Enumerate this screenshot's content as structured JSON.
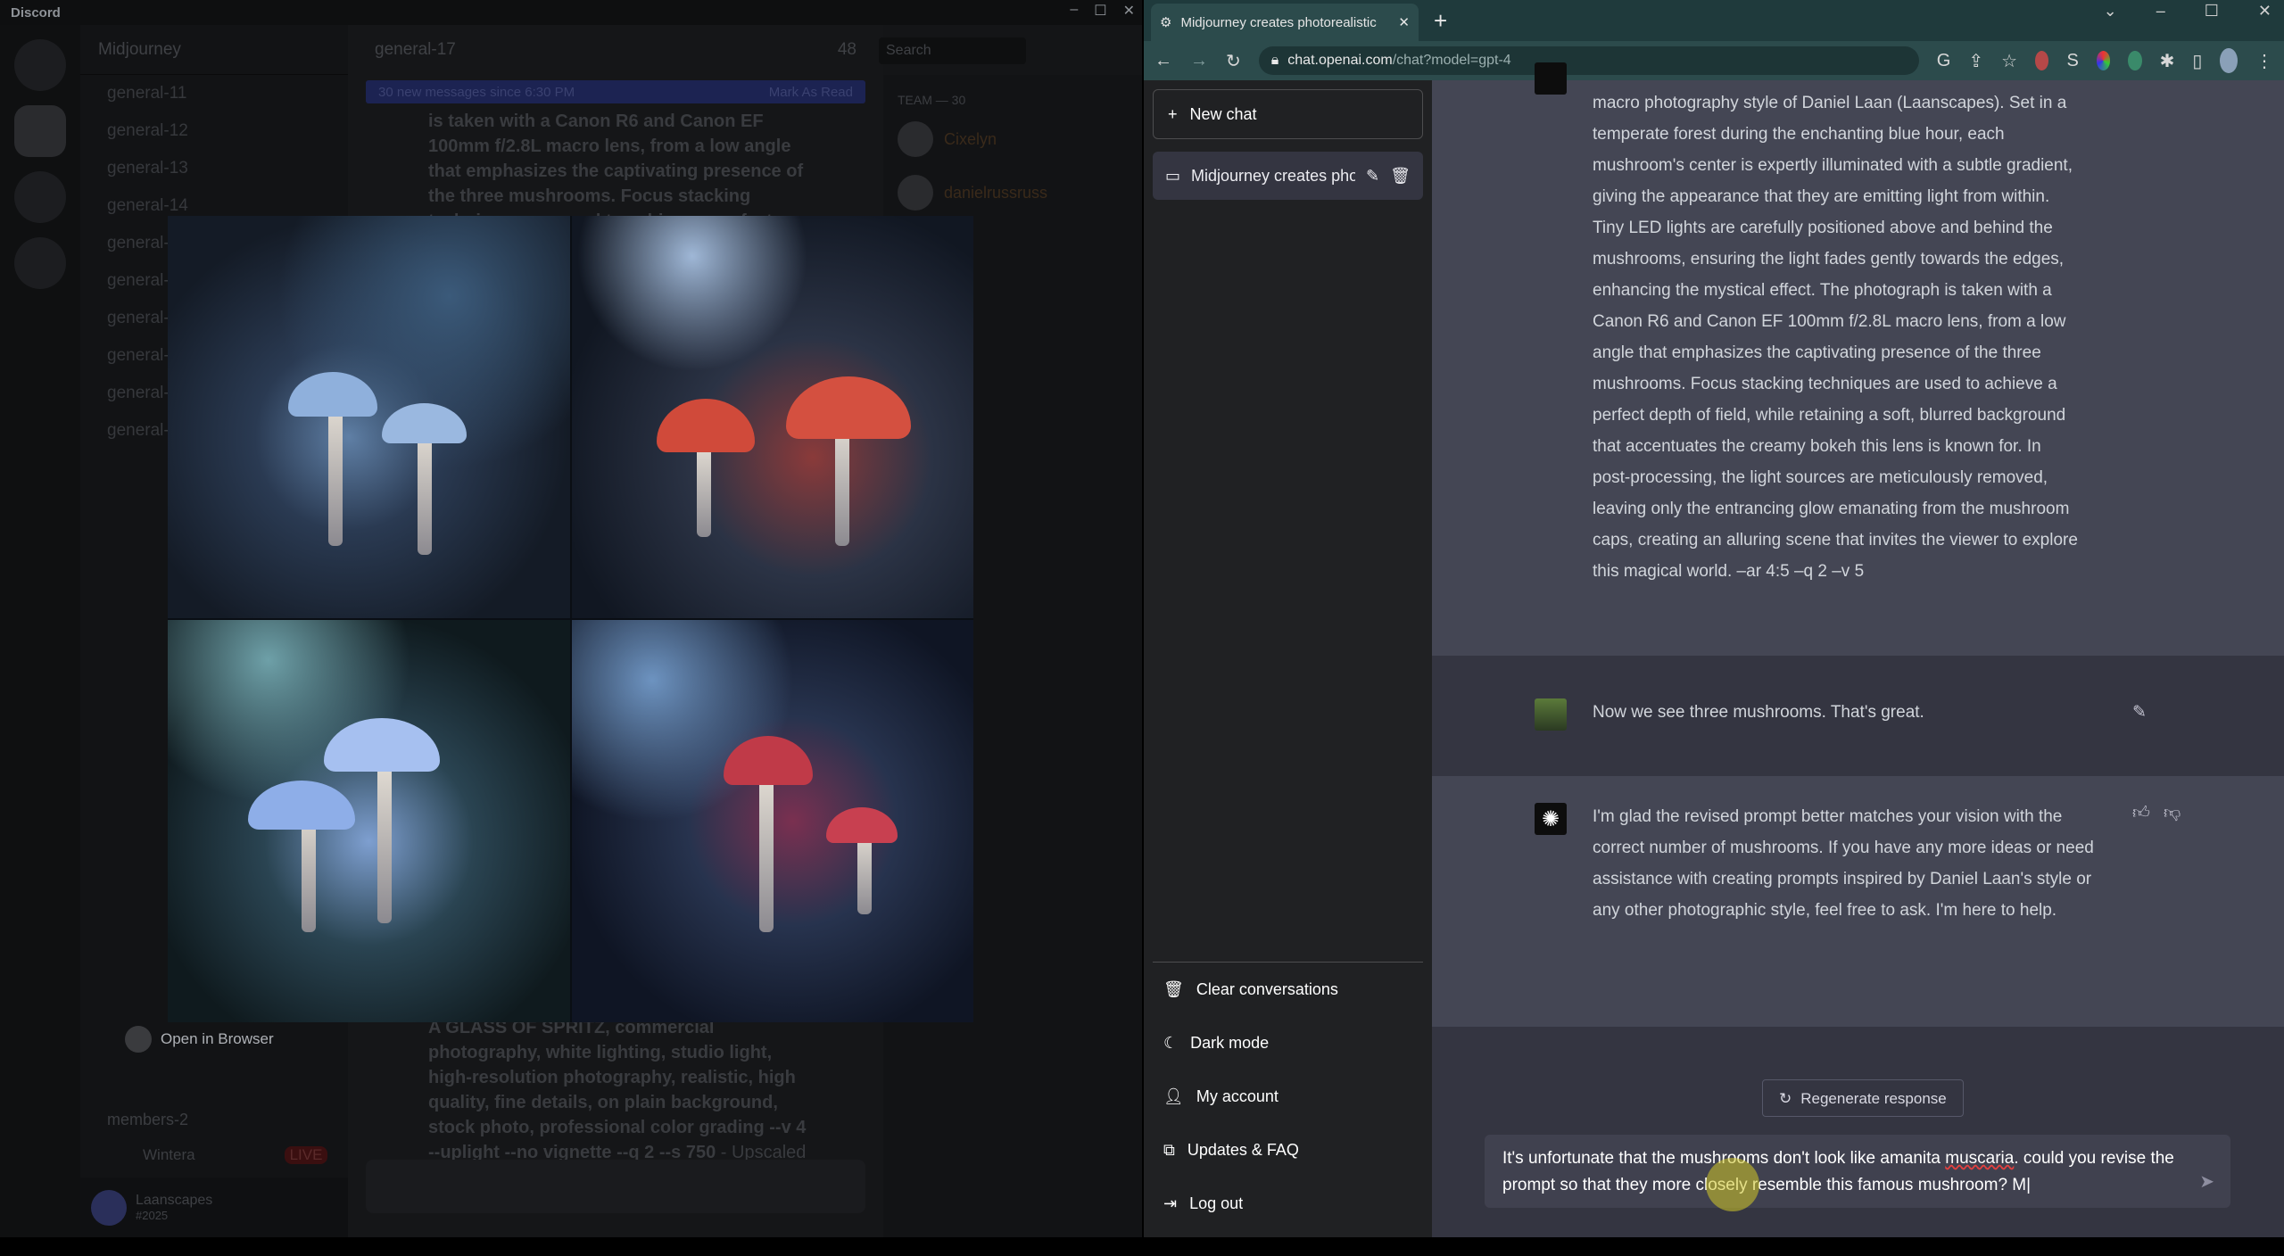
{
  "discord": {
    "app_title": "Discord",
    "server_name": "Midjourney",
    "channel_title": "general-17",
    "thread_count": "48",
    "search_placeholder": "Search",
    "channels": [
      "general-11",
      "general-12",
      "general-13",
      "general-14",
      "general-15",
      "general-16",
      "general-17",
      "general-18",
      "general-19",
      "general-20"
    ],
    "new_messages": "30 new messages since 6:30 PM",
    "mark_as_read": "Mark As Read",
    "message_top": "is taken with a Canon R6 and Canon EF 100mm f/2.8L macro lens, from a low angle that emphasizes the captivating presence of the three mushrooms. Focus stacking techniques are used to achieve a perfect depth of field",
    "message_bottom": "A GLASS OF SPRITZ, commercial photography, white lighting, studio light, high-resolution photography, realistic, high quality, fine details, on plain background, stock photo, professional color grading --v 4 --uplight --no vignette --q 2 --s 750",
    "upscaled_by": "- Upscaled by",
    "members_header": "TEAM — 30",
    "members": [
      "Cixelyn",
      "danielrussruss"
    ],
    "open_in_browser": "Open in Browser",
    "voice_channel": "members-2",
    "live_badge": "LIVE",
    "voice_user": "Wintera",
    "username": "Laanscapes",
    "user_tag": "#2025"
  },
  "browser": {
    "tab_title": "Midjourney creates photorealistic",
    "url_host": "chat.openai.com",
    "url_path": "/chat?model=gpt-4"
  },
  "sidebar": {
    "new_chat": "New chat",
    "conversation": "Midjourney creates pho",
    "footer": [
      {
        "icon": "trash-icon",
        "label": "Clear conversations"
      },
      {
        "icon": "moon-icon",
        "label": "Dark mode"
      },
      {
        "icon": "user-icon",
        "label": "My account"
      },
      {
        "icon": "external-link-icon",
        "label": "Updates & FAQ"
      },
      {
        "icon": "logout-icon",
        "label": "Log out"
      }
    ]
  },
  "chat": {
    "prompt_lines": [
      "macro photography style of Daniel Laan (Laanscapes). Set in a",
      "temperate forest during the enchanting blue hour, each",
      "mushroom's center is expertly illuminated with a subtle gradient,",
      "giving the appearance that they are emitting light from within.",
      "Tiny LED lights are carefully positioned above and behind the",
      "mushrooms, ensuring the light fades gently towards the edges,",
      "enhancing the mystical effect. The photograph is taken with a",
      "Canon R6 and Canon EF 100mm f/2.8L macro lens, from a low",
      "angle that emphasizes the captivating presence of the three",
      "mushrooms. Focus stacking techniques are used to achieve a",
      "perfect depth of field, while retaining a soft, blurred background",
      "that accentuates the creamy bokeh this lens is known for. In",
      "post-processing, the light sources are meticulously removed,",
      "leaving only the entrancing glow emanating from the mushroom",
      "caps, creating an alluring scene that invites the viewer to explore",
      "this magical world. –ar 4:5 –q 2 –v 5"
    ],
    "user_message": "Now we see three mushrooms. That's great.",
    "assistant_message": "I'm glad the revised prompt better matches your vision with the correct number of mushrooms. If you have any more ideas or need assistance with creating prompts inspired by Daniel Laan's style or any other photographic style, feel free to ask. I'm here to help.",
    "regenerate": "Regenerate response",
    "input_before": "It's unfortunate that the mushrooms don't look like amanita ",
    "input_misspelled": "muscaria",
    "input_after": ". could you revise the prompt so that they more closely resemble this famous mushroom? M"
  },
  "colors": {
    "sidebar": "#202123",
    "chat_bg": "#343541",
    "assistant_bg": "#444654",
    "browser_chrome": "#2c4b4c"
  }
}
